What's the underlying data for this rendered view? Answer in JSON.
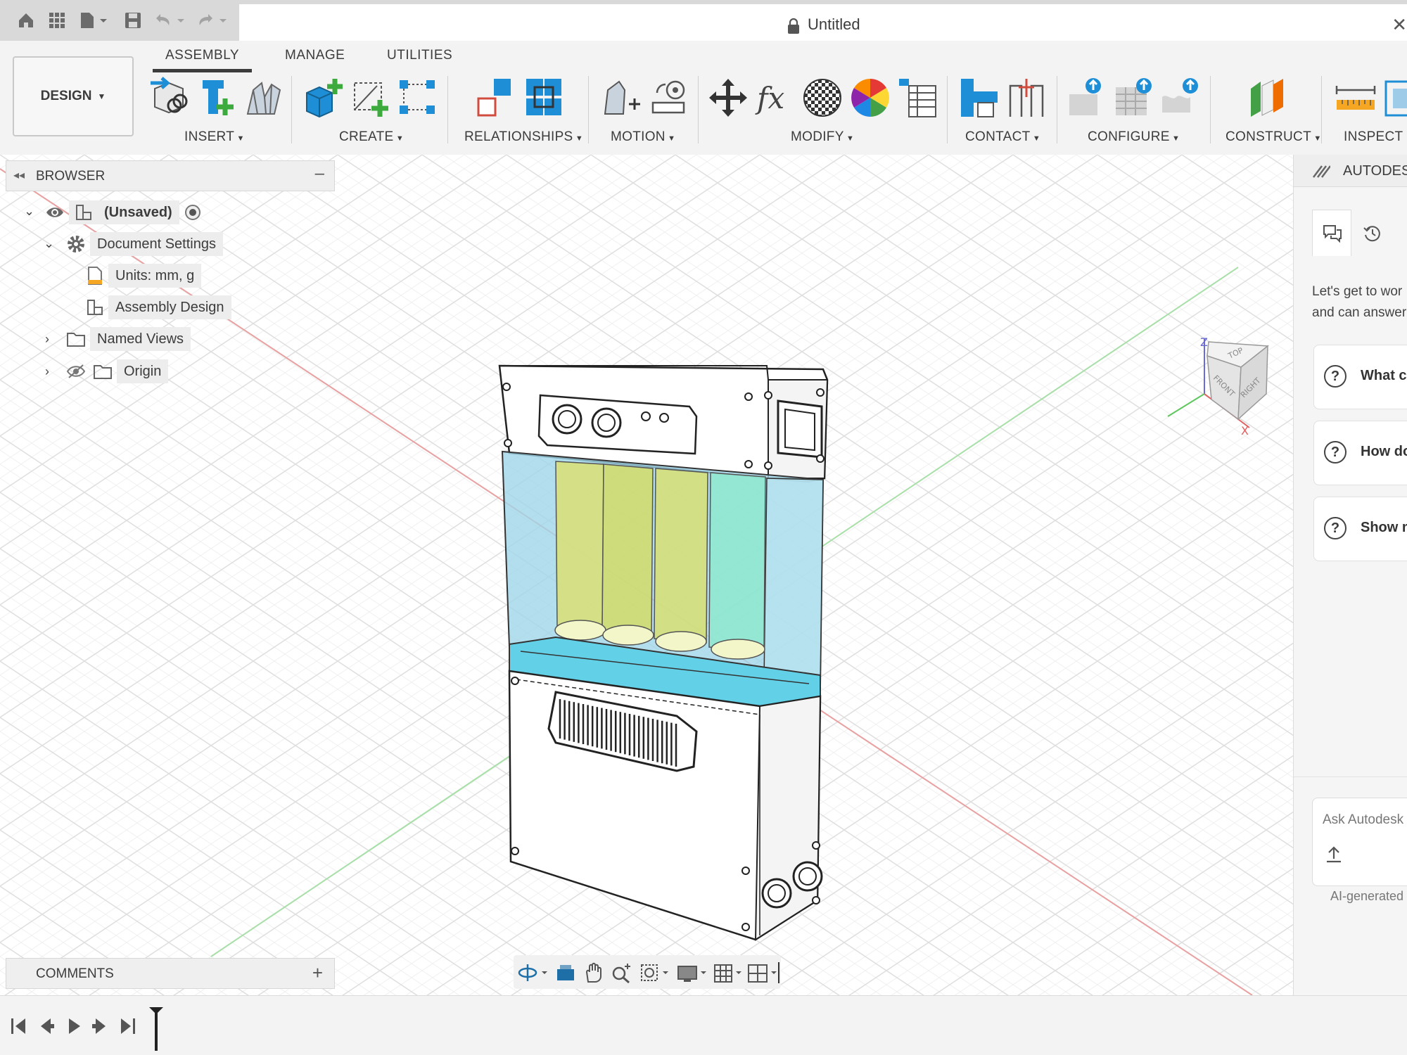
{
  "quick_access": {
    "icons": [
      "home-icon",
      "apps-grid-icon",
      "file-menu-icon",
      "save-icon",
      "undo-icon",
      "redo-icon"
    ]
  },
  "title_bar": {
    "title": "Untitled"
  },
  "ribbon": {
    "tabs": [
      {
        "label": "ASSEMBLY",
        "active": true
      },
      {
        "label": "MANAGE",
        "active": false
      },
      {
        "label": "UTILITIES",
        "active": false
      }
    ],
    "workspace": "DESIGN",
    "groups": {
      "insert": "INSERT",
      "create": "CREATE",
      "relationships": "RELATIONSHIPS",
      "motion": "MOTION",
      "modify": "MODIFY",
      "contact": "CONTACT",
      "configure": "CONFIGURE",
      "construct": "CONSTRUCT",
      "inspect": "INSPECT"
    },
    "accent": "#1e8fd6",
    "add_green": "#3daa3d"
  },
  "browser": {
    "title": "BROWSER",
    "root": "(Unsaved)",
    "items": {
      "document_settings": "Document Settings",
      "units": "Units: mm, g",
      "assembly_design": "Assembly Design",
      "named_views": "Named Views",
      "origin": "Origin"
    }
  },
  "viewcube": {
    "faces": {
      "top": "TOP",
      "front": "FRONT",
      "right": "RIGHT"
    },
    "axes": {
      "z": "Z",
      "x": "X"
    }
  },
  "assistant": {
    "title": "AUTODESK",
    "intro_line1": "Let's get to wor",
    "intro_line2": "and can answer",
    "suggestions": [
      "What ca",
      "How do",
      "Show m"
    ],
    "ask_placeholder": "Ask Autodesk",
    "disclaimer": "AI-generated"
  },
  "comments": {
    "title": "COMMENTS"
  }
}
